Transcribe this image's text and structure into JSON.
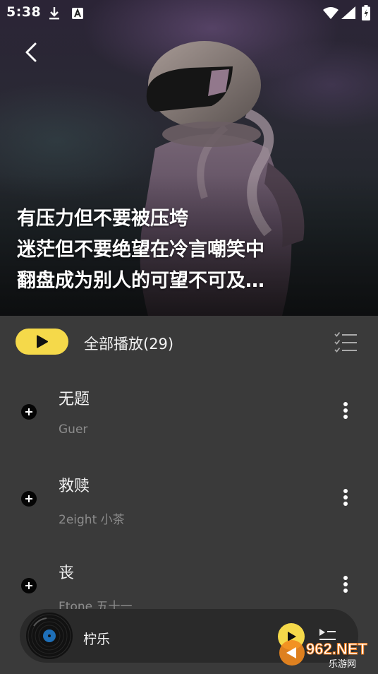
{
  "status_bar": {
    "time": "5:38",
    "icons": [
      "download-icon",
      "a-badge-icon",
      "wifi-icon",
      "signal-icon",
      "battery-icon"
    ]
  },
  "header": {
    "back_icon": "chevron-left-icon",
    "quote_lines": [
      "有压力但不要被压垮",
      "迷茫但不要绝望在冷言嘲笑中",
      "翻盘成为别人的可望不可及…"
    ]
  },
  "play_all": {
    "label": "全部播放(29)",
    "play_icon": "play-icon",
    "edit_icon": "list-check-icon"
  },
  "songs": [
    {
      "title": "无题",
      "artist": "Guer"
    },
    {
      "title": "救赎",
      "artist": "2eight 小茶"
    },
    {
      "title": "丧",
      "artist": "Ftone 五十一"
    }
  ],
  "mini_player": {
    "title": "柠乐",
    "play_icon": "play-icon",
    "queue_icon": "queue-icon"
  },
  "watermark": {
    "brand": "962.NET",
    "sub": "乐游网"
  },
  "colors": {
    "accent": "#f5d94a",
    "background": "#3a3a3a",
    "player_bg": "#2a2a2a",
    "text_primary": "#f2f2f2",
    "text_secondary": "#8c8c8c"
  }
}
